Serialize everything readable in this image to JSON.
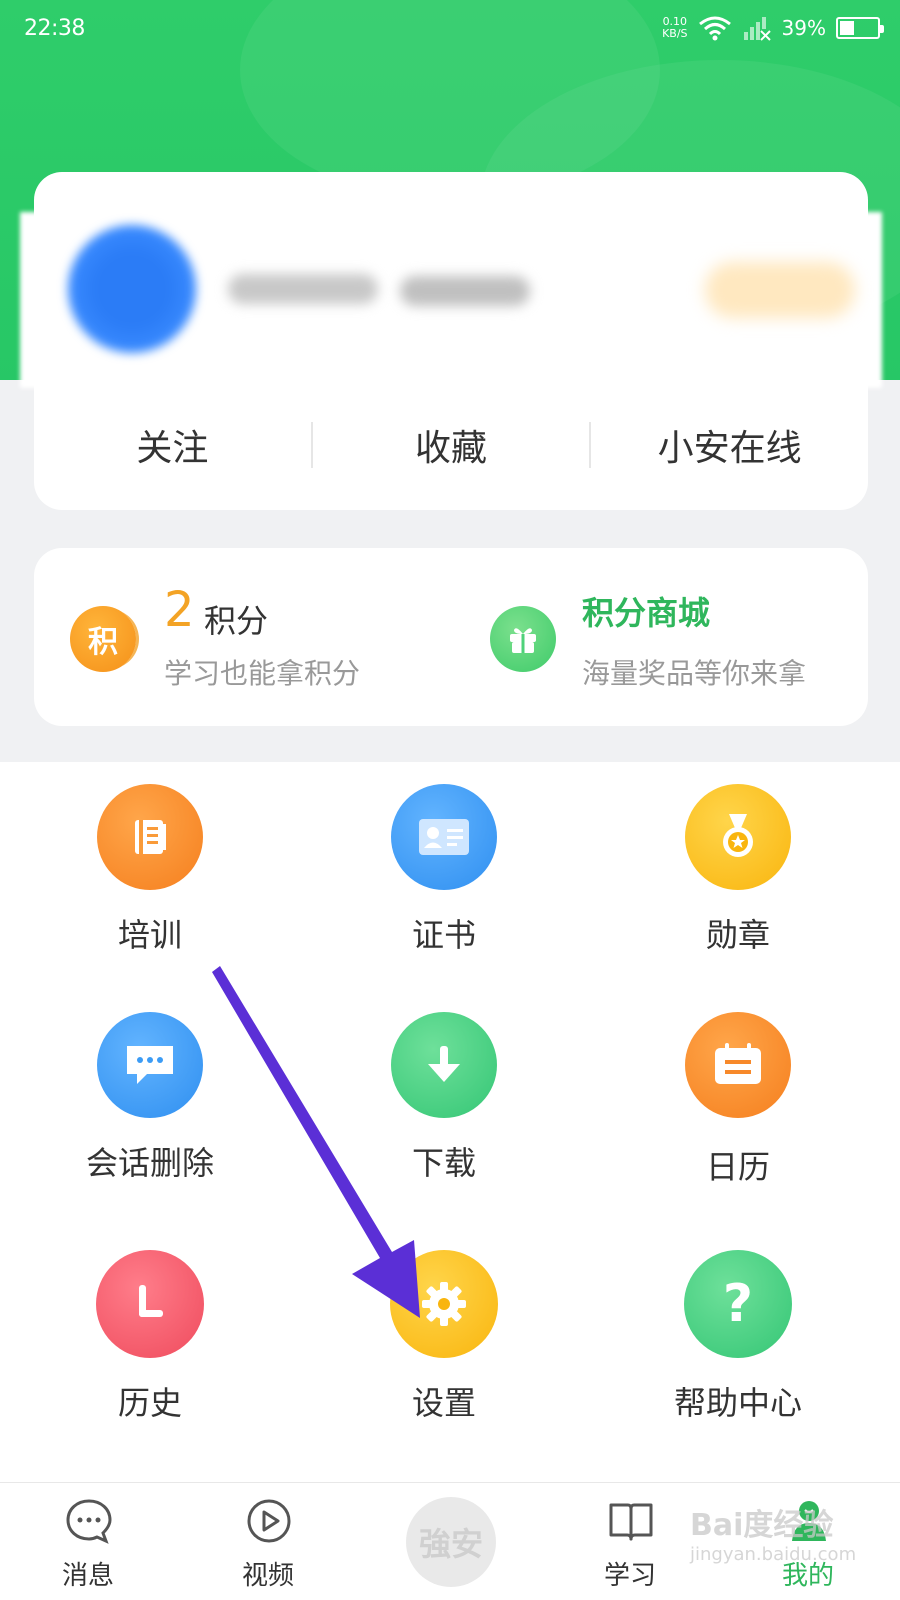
{
  "status_bar": {
    "time": "22:38",
    "net_speed_value": "0.10",
    "net_speed_unit": "KB/S",
    "battery": "39%",
    "battery_level": 0.39
  },
  "profile": {
    "links": [
      {
        "label": "关注"
      },
      {
        "label": "收藏"
      },
      {
        "label": "小安在线"
      }
    ]
  },
  "points": {
    "icon_text": "积",
    "value": "2",
    "unit": "积分",
    "subtitle": "学习也能拿积分"
  },
  "mall": {
    "title": "积分商城",
    "subtitle": "海量奖品等你来拿"
  },
  "grid": {
    "items": [
      {
        "label": "培训",
        "icon": "training-book-icon",
        "color": "#f7892a"
      },
      {
        "label": "证书",
        "icon": "certificate-card-icon",
        "color": "#3c9cf5"
      },
      {
        "label": "勋章",
        "icon": "medal-icon",
        "color": "#fbbf24"
      },
      {
        "label": "会话删除",
        "icon": "chat-bubble-icon",
        "color": "#3c9cf5"
      },
      {
        "label": "下载",
        "icon": "download-arrow-icon",
        "color": "#3dcf79"
      },
      {
        "label": "日历",
        "icon": "calendar-icon",
        "color": "#f7892a"
      },
      {
        "label": "历史",
        "icon": "clock-icon",
        "color": "#f25f6c"
      },
      {
        "label": "设置",
        "icon": "gear-icon",
        "color": "#fbbf24"
      },
      {
        "label": "帮助中心",
        "icon": "question-mark-icon",
        "color": "#3dcf79"
      }
    ]
  },
  "tab_bar": {
    "tabs": [
      {
        "label": "消息",
        "icon": "message-bubble-icon"
      },
      {
        "label": "视频",
        "icon": "play-circle-icon"
      },
      {
        "label": "学习",
        "icon": "open-book-icon"
      },
      {
        "label": "我的",
        "icon": "person-icon"
      }
    ],
    "center_label": "強安",
    "active_color": "#2fb65c"
  },
  "watermark": {
    "text": "Bai度经验",
    "url": "jingyan.baidu.com"
  },
  "colors": {
    "header_green": "#2fcd6a",
    "arrow_purple": "#5b2fd6"
  }
}
